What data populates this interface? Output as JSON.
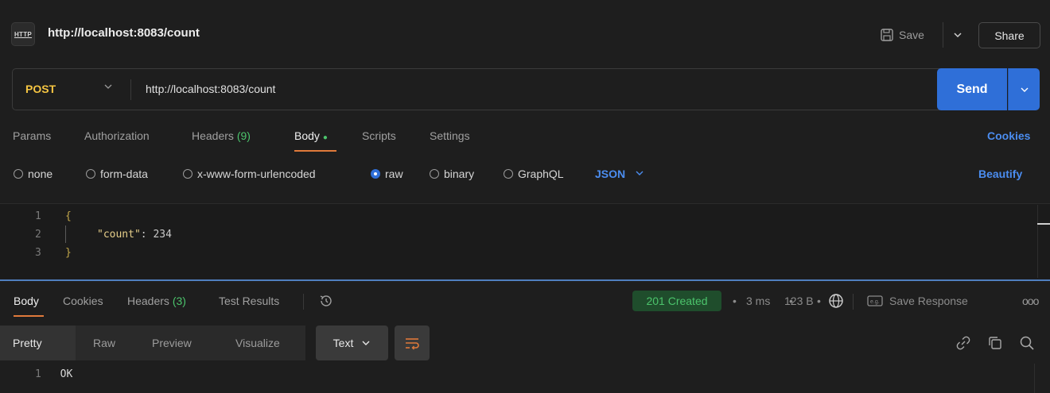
{
  "header": {
    "icon_text": "HTTP",
    "title": "http://localhost:8083/count",
    "save_label": "Save",
    "share_label": "Share"
  },
  "request": {
    "method": "POST",
    "url": "http://localhost:8083/count",
    "send_label": "Send"
  },
  "tabs": {
    "params": "Params",
    "authorization": "Authorization",
    "headers": "Headers",
    "headers_count": "(9)",
    "body": "Body",
    "body_dot": "●",
    "scripts": "Scripts",
    "settings": "Settings",
    "cookies": "Cookies"
  },
  "body_types": {
    "none": "none",
    "form_data": "form-data",
    "urlencoded": "x-www-form-urlencoded",
    "raw": "raw",
    "binary": "binary",
    "graphql": "GraphQL",
    "format": "JSON",
    "beautify": "Beautify",
    "selected": "raw"
  },
  "editor": {
    "line_numbers": [
      "1",
      "2",
      "3"
    ],
    "open_brace": "{",
    "key": "\"count\"",
    "colon": ": ",
    "value": "234",
    "close_brace": "}"
  },
  "response": {
    "tabs": {
      "body": "Body",
      "cookies": "Cookies",
      "headers": "Headers",
      "headers_count": "(3)",
      "test_results": "Test Results"
    },
    "status": "201 Created",
    "time": "3 ms",
    "size": "123 B",
    "save_response": "Save Response",
    "more": "ooo",
    "view_modes": {
      "pretty": "Pretty",
      "raw": "Raw",
      "preview": "Preview",
      "visualize": "Visualize"
    },
    "format": "Text",
    "line_number": "1",
    "content": "OK"
  },
  "colors": {
    "accent": "#2f6fd8",
    "method": "#f5c542",
    "status_ok": "#4cc46c",
    "tab_underline": "#e07a3b"
  }
}
